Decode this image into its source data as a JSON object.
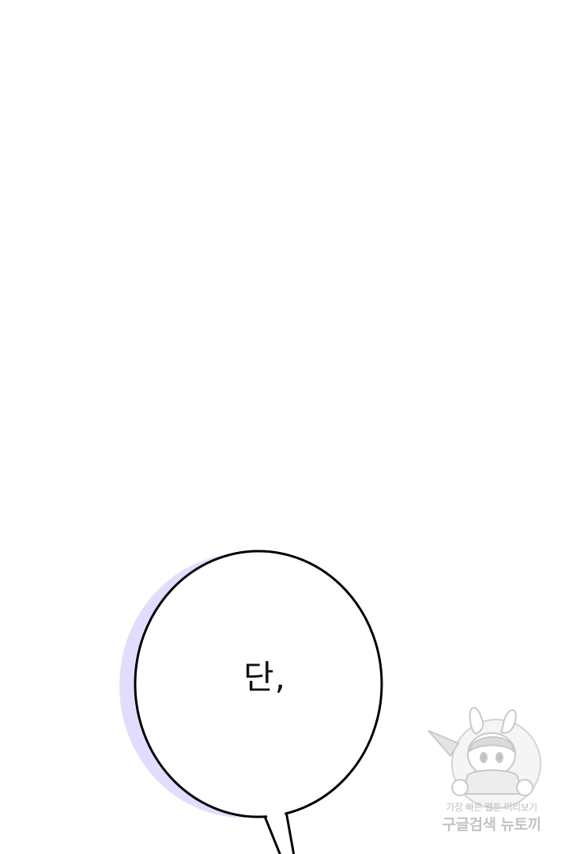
{
  "panel": {
    "background": "#ffffff"
  },
  "speech_bubble": {
    "text": "단,",
    "fill": "#ffffff",
    "outline": "#000000",
    "shadow_color": "#e3dcff"
  },
  "watermark": {
    "line1": "가장 빠른 웹툰 미리보기",
    "line2": "구글검색 뉴토끼",
    "color": "#c0c0c0",
    "icon": "bunny-girl-mascot-icon"
  }
}
